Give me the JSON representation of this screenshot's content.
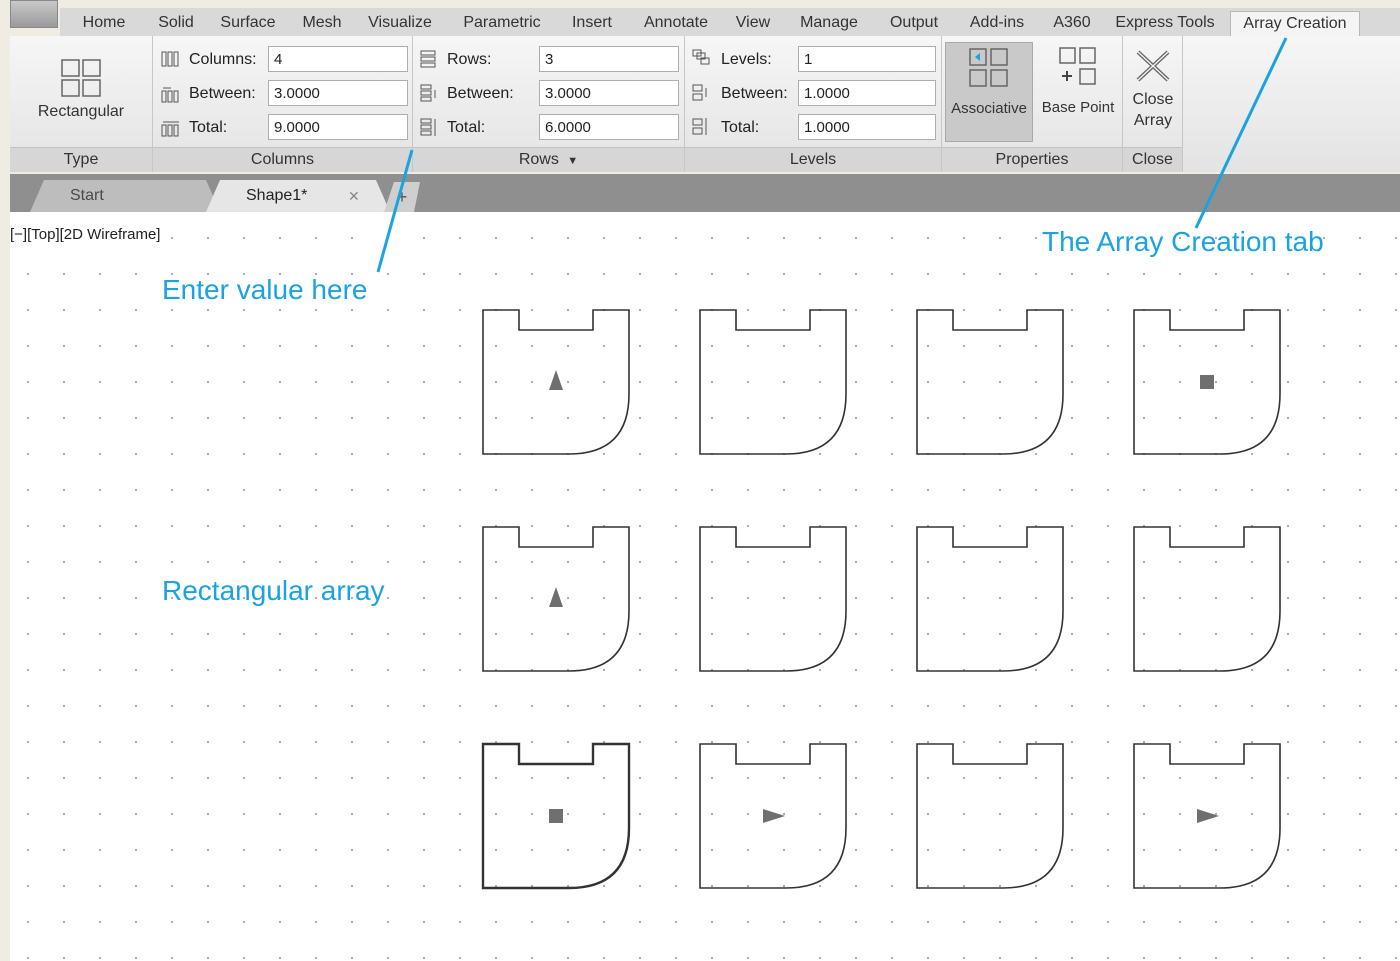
{
  "menu_tabs": [
    "Home",
    "Solid",
    "Surface",
    "Mesh",
    "Visualize",
    "Parametric",
    "Insert",
    "Annotate",
    "View",
    "Manage",
    "Output",
    "Add-ins",
    "A360",
    "Express Tools",
    "Array Creation"
  ],
  "ribbon": {
    "type_panel": {
      "title": "Type",
      "button_label": "Rectangular"
    },
    "columns_panel": {
      "title": "Columns",
      "columns_label": "Columns:",
      "columns_value": "4",
      "between_label": "Between:",
      "between_value": "3.0000",
      "total_label": "Total:",
      "total_value": "9.0000"
    },
    "rows_panel": {
      "title": "Rows",
      "rows_label": "Rows:",
      "rows_value": "3",
      "between_label": "Between:",
      "between_value": "3.0000",
      "total_label": "Total:",
      "total_value": "6.0000"
    },
    "levels_panel": {
      "title": "Levels",
      "levels_label": "Levels:",
      "levels_value": "1",
      "between_label": "Between:",
      "between_value": "1.0000",
      "total_label": "Total:",
      "total_value": "1.0000"
    },
    "properties_panel": {
      "title": "Properties",
      "associative_label": "Associative",
      "base_point_label": "Base Point"
    },
    "close_panel": {
      "title": "Close",
      "close_label_line1": "Close",
      "close_label_line2": "Array"
    }
  },
  "doc_tabs": [
    {
      "label": "Start",
      "active": false
    },
    {
      "label": "Shape1*",
      "active": true
    }
  ],
  "viewport_label": "[−][Top][2D Wireframe]",
  "callouts": {
    "enter_value": "Enter value here",
    "rectangular_array": "Rectangular array",
    "array_creation_tab": "The Array Creation tab"
  },
  "array_grid": {
    "rows": 3,
    "columns": 4,
    "markers": [
      [
        "triangle-up",
        "none",
        "none",
        "square"
      ],
      [
        "triangle-up",
        "none",
        "none",
        "none"
      ],
      [
        "square",
        "triangle-right",
        "none",
        "triangle-right"
      ]
    ]
  },
  "colors": {
    "accent": "#1aa3e0",
    "tab_bar": "#d9d9d9",
    "ribbon": "#eeeeee",
    "canvas": "#ffffff"
  },
  "icons": {
    "rectangular": "rectangular-array-icon",
    "columns": "columns-icon",
    "rows": "rows-icon",
    "levels": "levels-icon",
    "associative": "associative-icon",
    "base_point": "base-point-icon",
    "close": "close-array-icon"
  }
}
